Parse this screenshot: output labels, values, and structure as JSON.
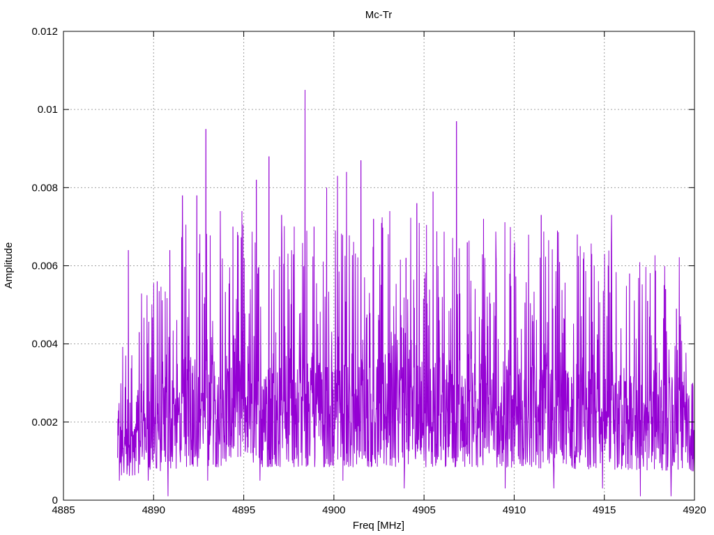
{
  "chart_data": {
    "type": "line",
    "title": "Mc-Tr",
    "xlabel": "Freq [MHz]",
    "ylabel": "Amplitude",
    "xlim": [
      4885,
      4920
    ],
    "ylim": [
      0,
      0.012
    ],
    "x_ticks": [
      4885,
      4890,
      4895,
      4900,
      4905,
      4910,
      4915,
      4920
    ],
    "y_ticks": [
      0,
      0.002,
      0.004,
      0.006,
      0.008,
      0.01,
      0.012
    ],
    "x_tick_labels": [
      "4885",
      "4890",
      "4895",
      "4900",
      "4905",
      "4910",
      "4915",
      "4920"
    ],
    "y_tick_labels": [
      "0",
      "0.002",
      "0.004",
      "0.006",
      "0.008",
      "0.01",
      "0.012"
    ],
    "grid": true,
    "series": [
      {
        "color": "#9400d3",
        "x_start": 4888.0,
        "x_end": 4920.0,
        "peaks": [
          {
            "x": 4888.6,
            "y": 0.0064
          },
          {
            "x": 4889.2,
            "y": 0.0043
          },
          {
            "x": 4890.2,
            "y": 0.0056
          },
          {
            "x": 4890.9,
            "y": 0.0064
          },
          {
            "x": 4891.6,
            "y": 0.0078
          },
          {
            "x": 4892.4,
            "y": 0.0078
          },
          {
            "x": 4892.9,
            "y": 0.0095
          },
          {
            "x": 4893.7,
            "y": 0.0074
          },
          {
            "x": 4894.4,
            "y": 0.007
          },
          {
            "x": 4894.9,
            "y": 0.0074
          },
          {
            "x": 4895.7,
            "y": 0.0082
          },
          {
            "x": 4896.4,
            "y": 0.0088
          },
          {
            "x": 4897.1,
            "y": 0.0073
          },
          {
            "x": 4897.8,
            "y": 0.007
          },
          {
            "x": 4898.4,
            "y": 0.0105
          },
          {
            "x": 4898.9,
            "y": 0.007
          },
          {
            "x": 4899.6,
            "y": 0.008
          },
          {
            "x": 4900.2,
            "y": 0.0083
          },
          {
            "x": 4900.7,
            "y": 0.0084
          },
          {
            "x": 4901.5,
            "y": 0.0087
          },
          {
            "x": 4902.2,
            "y": 0.0072
          },
          {
            "x": 4903.1,
            "y": 0.0074
          },
          {
            "x": 4904.0,
            "y": 0.0062
          },
          {
            "x": 4904.6,
            "y": 0.0076
          },
          {
            "x": 4905.5,
            "y": 0.0079
          },
          {
            "x": 4906.8,
            "y": 0.0097
          },
          {
            "x": 4907.4,
            "y": 0.0066
          },
          {
            "x": 4908.3,
            "y": 0.0072
          },
          {
            "x": 4909.0,
            "y": 0.0062
          },
          {
            "x": 4910.0,
            "y": 0.0062
          },
          {
            "x": 4911.5,
            "y": 0.0073
          },
          {
            "x": 4912.4,
            "y": 0.0069
          },
          {
            "x": 4913.5,
            "y": 0.0068
          },
          {
            "x": 4914.3,
            "y": 0.0063
          },
          {
            "x": 4915.4,
            "y": 0.0073
          },
          {
            "x": 4916.4,
            "y": 0.0058
          },
          {
            "x": 4917.4,
            "y": 0.0051
          },
          {
            "x": 4918.4,
            "y": 0.0054
          },
          {
            "x": 4919.0,
            "y": 0.0049
          },
          {
            "x": 4919.9,
            "y": 0.003
          }
        ],
        "minima": [
          {
            "x": 4888.1,
            "y": 0.0005
          },
          {
            "x": 4889.7,
            "y": 0.0005
          },
          {
            "x": 4890.8,
            "y": 0.0001
          },
          {
            "x": 4893.0,
            "y": 0.0005
          },
          {
            "x": 4895.9,
            "y": 0.0005
          },
          {
            "x": 4900.5,
            "y": 0.0005
          },
          {
            "x": 4903.9,
            "y": 0.0003
          },
          {
            "x": 4909.5,
            "y": 0.0003
          },
          {
            "x": 4912.2,
            "y": 0.0003
          },
          {
            "x": 4914.9,
            "y": 0.0003
          },
          {
            "x": 4917.0,
            "y": 0.0001
          },
          {
            "x": 4918.7,
            "y": 0.0001
          }
        ]
      }
    ]
  }
}
